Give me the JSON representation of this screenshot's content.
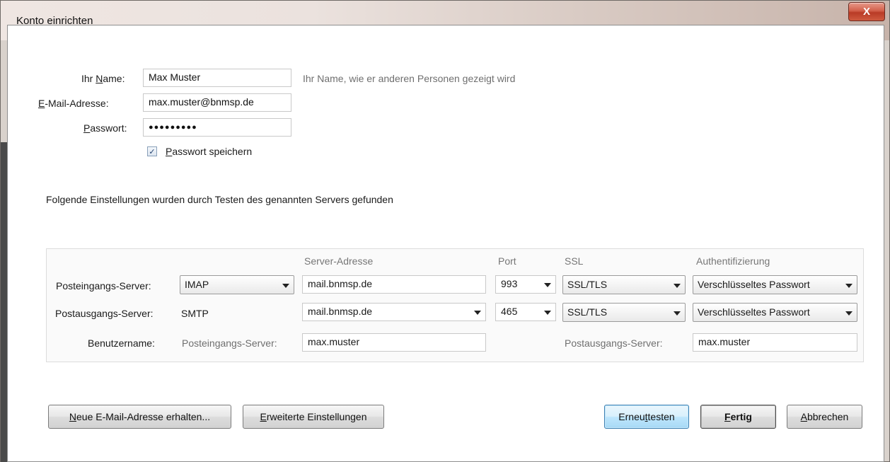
{
  "window": {
    "title": "Konto einrichten",
    "close_glyph": "X"
  },
  "account": {
    "name_label_pre": "Ihr ",
    "name_label_key": "N",
    "name_label_post": "ame:",
    "name_value": "Max Muster",
    "name_hint": "Ihr Name, wie er anderen Personen gezeigt wird",
    "email_label_key": "E",
    "email_label_post": "-Mail-Adresse:",
    "email_value": "max.muster@bnmsp.de",
    "password_label_key": "P",
    "password_label_post": "asswort:",
    "password_value": "●●●●●●●●●",
    "remember_key": "P",
    "remember_label_post": "asswort speichern",
    "remember_checked": true
  },
  "found_message": "Folgende Einstellungen wurden durch Testen des genannten Servers gefunden",
  "servers": {
    "headers": {
      "address": "Server-Adresse",
      "port": "Port",
      "ssl": "SSL",
      "auth": "Authentifizierung"
    },
    "incoming": {
      "label": "Posteingangs-Server:",
      "protocol": "IMAP",
      "address": "mail.bnmsp.de",
      "port": "993",
      "ssl": "SSL/TLS",
      "auth": "Verschlüsseltes Passwort"
    },
    "outgoing": {
      "label": "Postausgangs-Server:",
      "protocol": "SMTP",
      "address": "mail.bnmsp.de",
      "port": "465",
      "ssl": "SSL/TLS",
      "auth": "Verschlüsseltes Passwort"
    },
    "username": {
      "label": "Benutzername:",
      "incoming_label": "Posteingangs-Server:",
      "incoming_value": "max.muster",
      "outgoing_label": "Postausgangs-Server:",
      "outgoing_value": "max.muster"
    }
  },
  "buttons": {
    "new_email_key": "N",
    "new_email_post": "eue E-Mail-Adresse erhalten...",
    "advanced_key": "E",
    "advanced_post": "rweiterte Einstellungen",
    "retest_pre": "Erneu",
    "retest_key": "t",
    "retest_post": " testen",
    "done_key": "F",
    "done_post": "ertig",
    "cancel_key": "A",
    "cancel_post": "bbrechen"
  }
}
